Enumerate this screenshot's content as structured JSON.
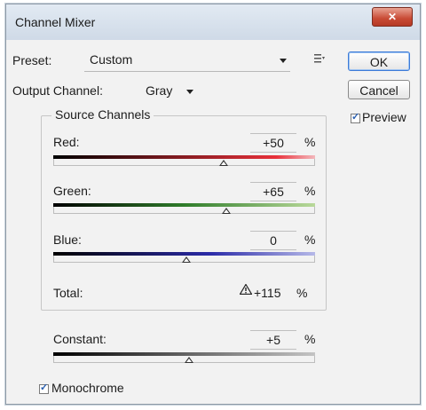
{
  "window": {
    "title": "Channel Mixer",
    "close_glyph": "✕"
  },
  "preset": {
    "label": "Preset:",
    "value": "Custom"
  },
  "output_channel": {
    "label": "Output Channel:",
    "value": "Gray"
  },
  "buttons": {
    "ok": "OK",
    "cancel": "Cancel"
  },
  "preview": {
    "label": "Preview",
    "checked": true
  },
  "source_channels": {
    "title": "Source Channels",
    "red": {
      "label": "Red:",
      "value": "+50",
      "unit": "%",
      "fraction": 0.65
    },
    "green": {
      "label": "Green:",
      "value": "+65",
      "unit": "%",
      "fraction": 0.66
    },
    "blue": {
      "label": "Blue:",
      "value": "0",
      "unit": "%",
      "fraction": 0.51
    }
  },
  "total": {
    "label": "Total:",
    "value": "+115",
    "unit": "%"
  },
  "constant": {
    "label": "Constant:",
    "value": "+5",
    "unit": "%",
    "fraction": 0.52
  },
  "monochrome": {
    "label": "Monochrome",
    "checked": true
  },
  "colors": {
    "red_gradient_end": "#e8303a",
    "green_gradient_end": "#7fb34a",
    "blue_gradient_end": "#3a3ac8",
    "gray_gradient_end": "#c4c4c4"
  }
}
